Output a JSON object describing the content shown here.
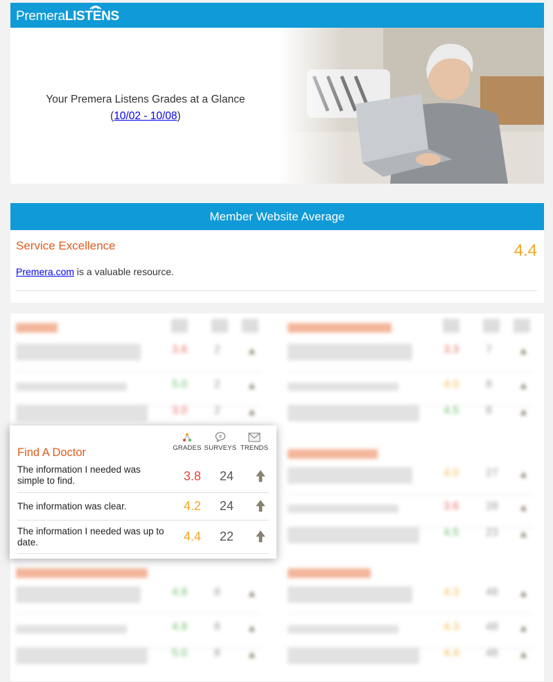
{
  "header": {
    "brand_light": "Premera",
    "brand_bold": "LISTENS"
  },
  "hero": {
    "line1": "Your Premera Listens Grades at a Glance",
    "open_paren": "(",
    "date_range": "10/02 - 10/08",
    "close_paren": ")"
  },
  "member_website": {
    "title": "Member Website Average",
    "section_title": "Service Excellence",
    "score": "4.4",
    "link_text": "Premera.com",
    "statement_rest": " is a valuable resource."
  },
  "popup": {
    "title": "Find A Doctor",
    "col_grades": "GRADES",
    "col_surveys": "SURVEYS",
    "col_trends": "TRENDS",
    "rows": [
      {
        "question": "The information I needed was simple to find.",
        "grade": "3.8",
        "surveys": "24",
        "trend": "up-arrow-icon"
      },
      {
        "question": "The information was clear.",
        "grade": "4.2",
        "surveys": "24",
        "trend": "up-arrow-icon"
      },
      {
        "question": "The information I needed was up to date.",
        "grade": "4.4",
        "surveys": "22",
        "trend": "up-arrow-icon"
      }
    ]
  },
  "colors": {
    "brand_blue": "#109ad7",
    "title_orange": "#e05b1e",
    "grade_red": "#e04a3a",
    "grade_amber": "#f5a623",
    "grade_green": "#5cb85c"
  }
}
